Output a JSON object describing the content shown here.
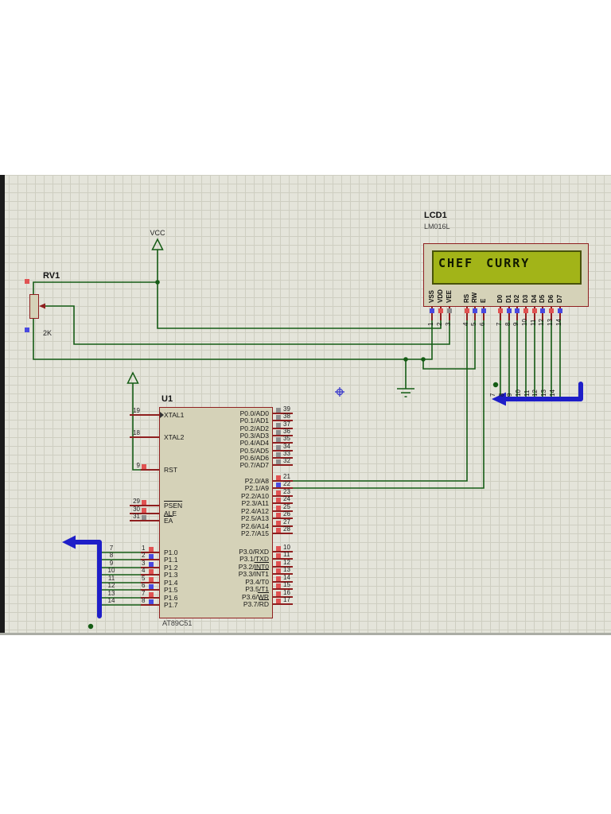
{
  "schematic": {
    "power_label": "VCC",
    "pot": {
      "ref": "RV1",
      "value": "2K"
    },
    "lcd": {
      "ref": "LCD1",
      "part": "LM016L",
      "display_text": "CHEF CURRY",
      "pins": [
        {
          "num": "1",
          "name": "VSS",
          "state": "blue"
        },
        {
          "num": "2",
          "name": "VDD",
          "state": "red"
        },
        {
          "num": "3",
          "name": "VEE",
          "state": "gray"
        },
        {
          "num": "4",
          "name": "RS",
          "state": "red"
        },
        {
          "num": "5",
          "name": "RW",
          "state": "blue"
        },
        {
          "num": "6",
          "name": "E",
          "state": "blue"
        },
        {
          "num": "7",
          "name": "D0",
          "state": "red"
        },
        {
          "num": "8",
          "name": "D1",
          "state": "blue"
        },
        {
          "num": "9",
          "name": "D2",
          "state": "blue"
        },
        {
          "num": "10",
          "name": "D3",
          "state": "red"
        },
        {
          "num": "11",
          "name": "D4",
          "state": "red"
        },
        {
          "num": "12",
          "name": "D5",
          "state": "blue"
        },
        {
          "num": "13",
          "name": "D6",
          "state": "red"
        },
        {
          "num": "14",
          "name": "D7",
          "state": "blue"
        }
      ]
    },
    "mcu": {
      "ref": "U1",
      "part": "AT89C51",
      "left_pins": [
        {
          "num": "19",
          "label": "XTAL1",
          "state": null,
          "clk": true
        },
        {
          "num": "18",
          "label": "XTAL2",
          "state": null
        },
        {
          "num": "9",
          "label": "RST",
          "state": "red"
        },
        {
          "num": "29",
          "label": "",
          "bar": "PSEN",
          "state": "red"
        },
        {
          "num": "30",
          "label": "ALE",
          "state": "red"
        },
        {
          "num": "31",
          "label": "",
          "bar": "EA",
          "state": "gray"
        },
        {
          "num": "1",
          "label": "P1.0",
          "state": "red"
        },
        {
          "num": "2",
          "label": "P1.1",
          "state": "blue"
        },
        {
          "num": "3",
          "label": "P1.2",
          "state": "blue"
        },
        {
          "num": "4",
          "label": "P1.3",
          "state": "red"
        },
        {
          "num": "5",
          "label": "P1.4",
          "state": "red"
        },
        {
          "num": "6",
          "label": "P1.5",
          "state": "blue"
        },
        {
          "num": "7",
          "label": "P1.6",
          "state": "red"
        },
        {
          "num": "8",
          "label": "P1.7",
          "state": "blue"
        }
      ],
      "right_pins": [
        {
          "num": "39",
          "label": "P0.0/AD0",
          "state": "gray"
        },
        {
          "num": "38",
          "label": "P0.1/AD1",
          "state": "gray"
        },
        {
          "num": "37",
          "label": "P0.2/AD2",
          "state": "gray"
        },
        {
          "num": "36",
          "label": "P0.3/AD3",
          "state": "gray"
        },
        {
          "num": "35",
          "label": "P0.4/AD4",
          "state": "gray"
        },
        {
          "num": "34",
          "label": "P0.5/AD5",
          "state": "gray"
        },
        {
          "num": "33",
          "label": "P0.6/AD6",
          "state": "gray"
        },
        {
          "num": "32",
          "label": "P0.7/AD7",
          "state": "gray"
        },
        {
          "num": "21",
          "label": "P2.0/A8",
          "state": "red"
        },
        {
          "num": "22",
          "label": "P2.1/A9",
          "state": "blue"
        },
        {
          "num": "23",
          "label": "P2.2/A10",
          "state": "red"
        },
        {
          "num": "24",
          "label": "P2.3/A11",
          "state": "red"
        },
        {
          "num": "25",
          "label": "P2.4/A12",
          "state": "red"
        },
        {
          "num": "26",
          "label": "P2.5/A13",
          "state": "red"
        },
        {
          "num": "27",
          "label": "P2.6/A14",
          "state": "red"
        },
        {
          "num": "28",
          "label": "P2.7/A15",
          "state": "red"
        },
        {
          "num": "10",
          "label": "P3.0/RXD",
          "state": "red"
        },
        {
          "num": "11",
          "label": "P3.1/TXD",
          "state": "red"
        },
        {
          "num": "12",
          "label": "P3.2/",
          "bar": "INT0",
          "state": "red"
        },
        {
          "num": "13",
          "label": "P3.3/",
          "bar": "INT1",
          "state": "red"
        },
        {
          "num": "14",
          "label": "P3.4/T0",
          "state": "red"
        },
        {
          "num": "15",
          "label": "P3.5/T1",
          "state": "red"
        },
        {
          "num": "16",
          "label": "P3.6/",
          "bar": "WR",
          "state": "red"
        },
        {
          "num": "17",
          "label": "P3.7/",
          "bar": "RD",
          "state": "red"
        }
      ]
    },
    "bus_net_labels": [
      "7",
      "8",
      "9",
      "10",
      "11",
      "12",
      "13",
      "14"
    ]
  },
  "colors": {
    "wire": "#155c15",
    "bus": "#1e1ec8",
    "component_outline": "#8f1f1f",
    "component_fill": "#d5d2b8",
    "lcd_screen": "#a2b418",
    "lcd_screen_border": "#49530a",
    "lcd_text": "#101800",
    "state_red": "#e05252",
    "state_blue": "#4949e0",
    "state_gray": "#8e8e8e",
    "grid_bg": "#e4e4da",
    "grid_line": "#cecec1"
  }
}
